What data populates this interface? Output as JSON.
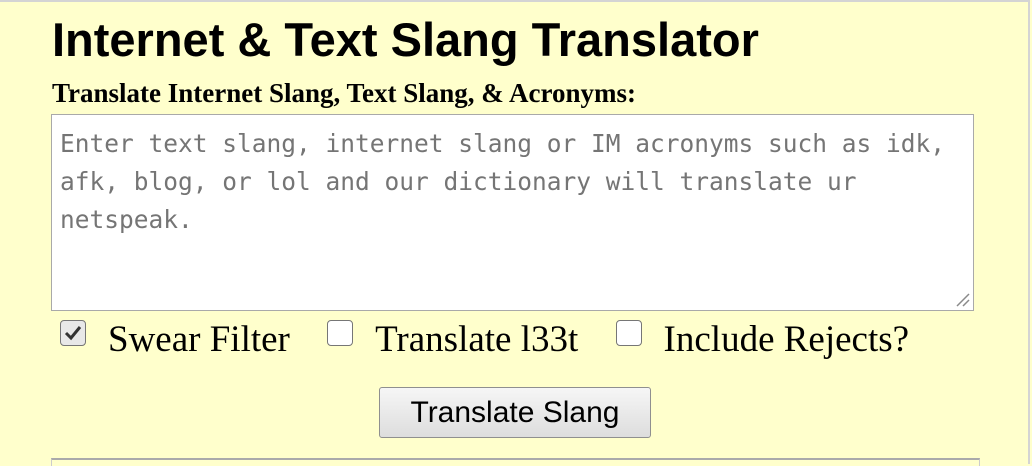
{
  "page": {
    "title": "Internet & Text Slang Translator",
    "subtitle": "Translate Internet Slang, Text Slang, & Acronyms:"
  },
  "input": {
    "placeholder": "Enter text slang, internet slang or IM acronyms such as idk, afk, blog, or lol and our dictionary will translate ur netspeak.",
    "value": ""
  },
  "options": [
    {
      "label": "Swear Filter",
      "checked": true
    },
    {
      "label": "Translate l33t",
      "checked": false
    },
    {
      "label": "Include Rejects?",
      "checked": false
    }
  ],
  "button": {
    "label": "Translate Slang"
  },
  "colors": {
    "background": "#ffffcc",
    "border": "#a9a9a9"
  }
}
